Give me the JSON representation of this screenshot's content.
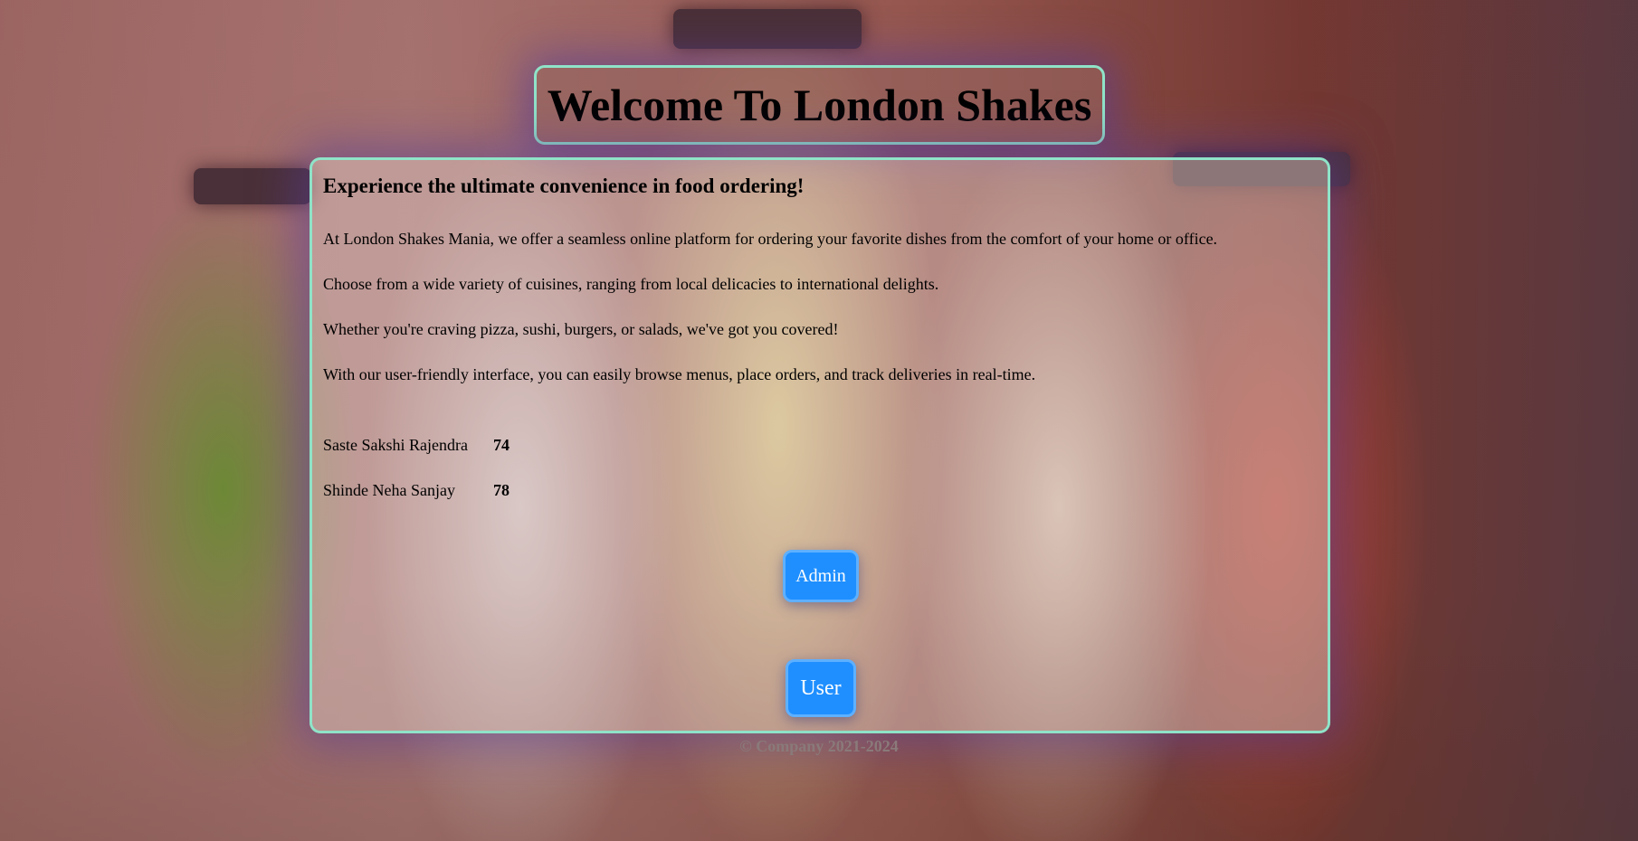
{
  "header": {
    "title": "Welcome To London Shakes"
  },
  "main": {
    "headline": "Experience the ultimate convenience in food ordering!",
    "paragraphs": [
      "At London Shakes Mania, we offer a seamless online platform for ordering your favorite dishes from the comfort of your home or office.",
      "Choose from a wide variety of cuisines, ranging from local delicacies to international delights.",
      "Whether you're craving pizza, sushi, burgers, or salads, we've got you covered!",
      "With our user-friendly interface, you can easily browse menus, place orders, and track deliveries in real-time."
    ],
    "members": [
      {
        "name": "Saste Sakshi Rajendra",
        "roll": "74"
      },
      {
        "name": "Shinde Neha Sanjay",
        "roll": "78"
      }
    ],
    "buttons": {
      "admin": "Admin",
      "user": "User"
    }
  },
  "footer": {
    "text": "© Company 2021-2024"
  },
  "colors": {
    "accent_border": "#8fe3c8",
    "button": "#1f8fff",
    "button_text": "#ffffff"
  }
}
